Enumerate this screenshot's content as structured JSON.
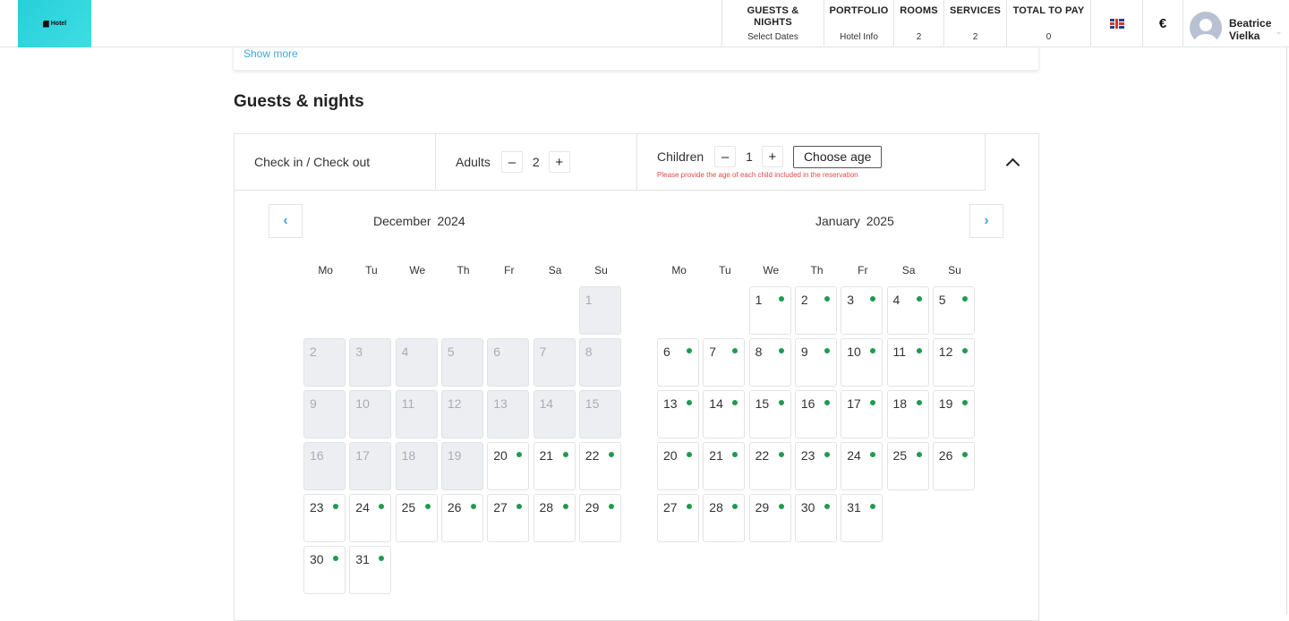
{
  "header": {
    "logo_text": "Hotel",
    "nav": [
      {
        "title": "GUESTS & NIGHTS",
        "value": "Select Dates"
      },
      {
        "title": "PORTFOLIO",
        "value": "Hotel Info"
      },
      {
        "title": "ROOMS",
        "value": "2"
      },
      {
        "title": "SERVICES",
        "value": "2"
      },
      {
        "title": "TOTAL TO PAY",
        "value": "0"
      }
    ],
    "language_icon": "uk-flag-icon",
    "currency": "€",
    "user": {
      "first_name": "Beatrice",
      "last_name": "Vielka"
    }
  },
  "top_card": {
    "show_more": "Show more"
  },
  "section_title": "Guests & nights",
  "panel": {
    "checkin_label": "Check in / Check out",
    "adults_label": "Adults",
    "adults_value": "2",
    "children_label": "Children",
    "children_value": "1",
    "choose_age_label": "Choose age",
    "age_warning": "Please provide the age of each child included in the reservation",
    "minus": "–",
    "plus": "+"
  },
  "colors": {
    "accent": "#3fa6dc",
    "available_dot": "#1e9b4e",
    "warning": "#e34a4a",
    "disabled_day": "#eceef2",
    "logo_bg": "#2ad3dc"
  },
  "calendar": {
    "weekdays": [
      "Mo",
      "Tu",
      "We",
      "Th",
      "Fr",
      "Sa",
      "Su"
    ],
    "months": [
      {
        "month": "December",
        "year": "2024",
        "first_weekday_index": 6,
        "days": 31,
        "disabled_until": 19,
        "available_from": 20
      },
      {
        "month": "January",
        "year": "2025",
        "first_weekday_index": 2,
        "days": 31,
        "disabled_until": 0,
        "available_from": 1
      }
    ]
  }
}
